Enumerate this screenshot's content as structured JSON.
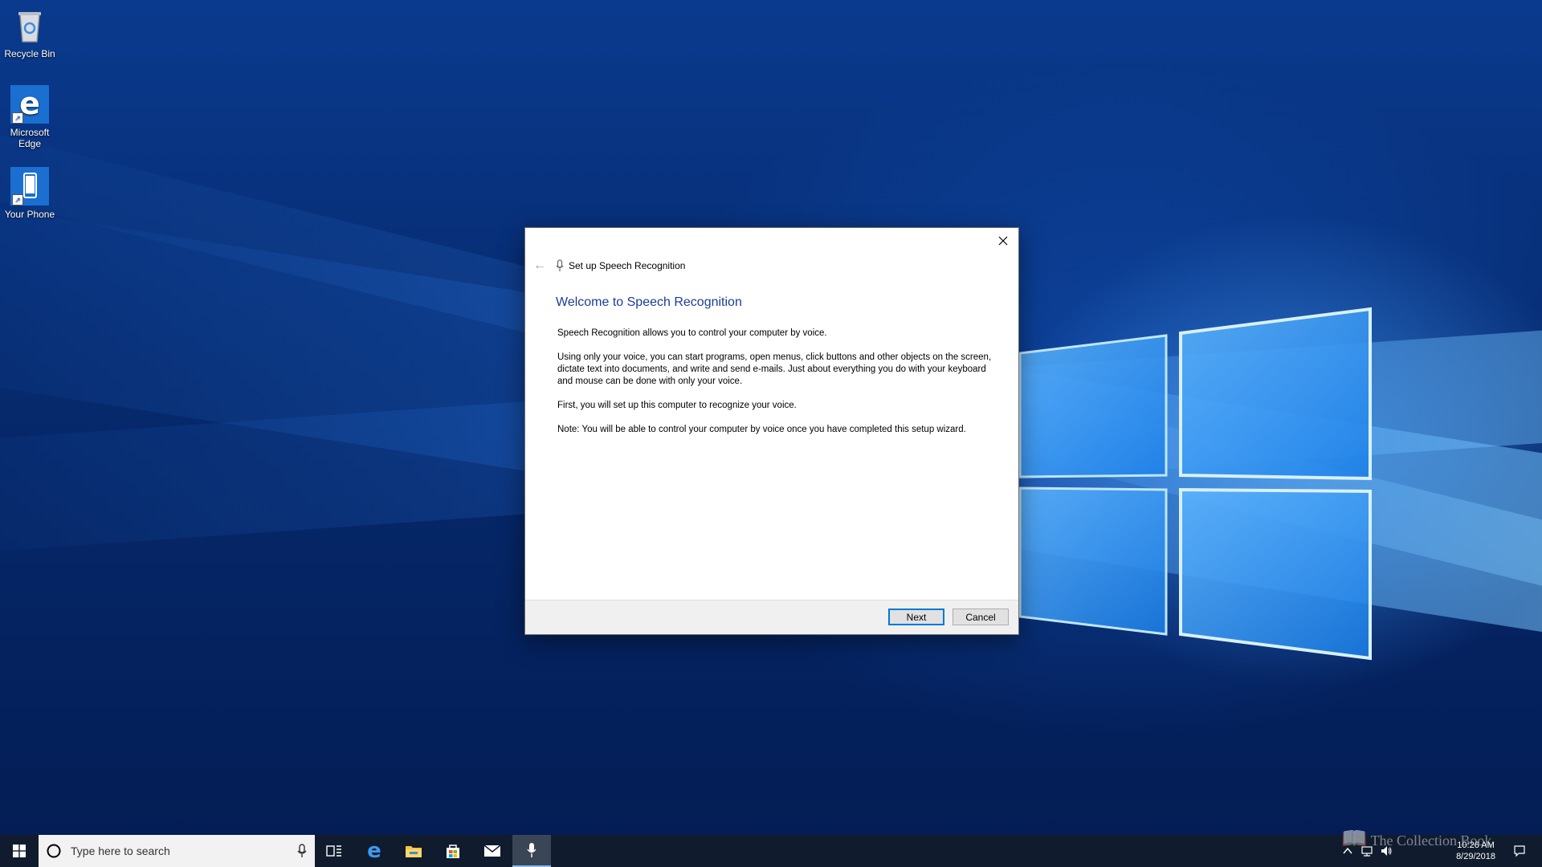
{
  "desktop": {
    "icons": [
      {
        "label": "Recycle Bin"
      },
      {
        "label": "Microsoft Edge"
      },
      {
        "label": "Your Phone"
      }
    ]
  },
  "dialog": {
    "title": "Set up Speech Recognition",
    "heading": "Welcome to Speech Recognition",
    "paragraphs": [
      "Speech Recognition allows you to control your computer by voice.",
      "Using only your voice, you can start programs, open menus, click buttons and other objects on the screen, dictate text into documents, and write and send e-mails. Just about everything you do with your keyboard and mouse can be done with only your voice.",
      "First, you will set up this computer to recognize your voice.",
      "Note: You will be able to control your computer by voice once you have completed this setup wizard."
    ],
    "next_label": "Next",
    "cancel_label": "Cancel"
  },
  "taskbar": {
    "search_placeholder": "Type here to search",
    "apps": [
      "task-view",
      "microsoft-edge",
      "file-explorer",
      "microsoft-store",
      "mail",
      "speech-recognition"
    ],
    "watermark": "The Collection Book",
    "time": "10:26 AM",
    "date": "8/29/2018"
  },
  "colors": {
    "accent": "#0078d7",
    "heading": "#1c3c96",
    "taskbar": "#101c2e"
  }
}
